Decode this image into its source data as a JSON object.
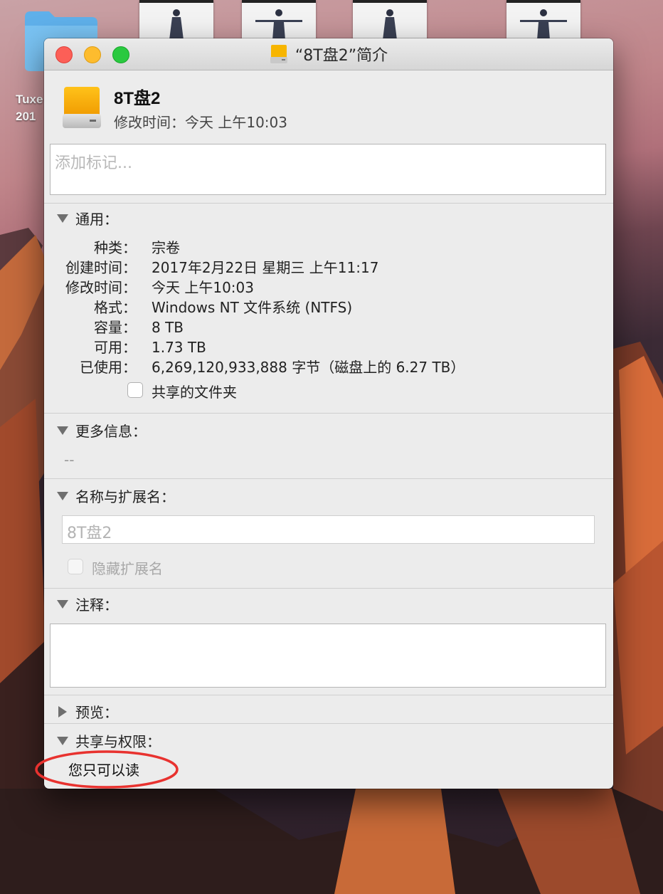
{
  "desktop": {
    "folder_label_line1": "Tuxe",
    "folder_label_line2": "201"
  },
  "window": {
    "title": "“8T盘2”简介",
    "traffic_lights": [
      "close",
      "minimize",
      "zoom"
    ]
  },
  "header": {
    "name": "8T盘2",
    "modified": "修改时间：今天 上午10:03",
    "tags_placeholder": "添加标记..."
  },
  "general": {
    "heading": "通用：",
    "rows": [
      {
        "label": "种类：",
        "value": "宗卷"
      },
      {
        "label": "创建时间：",
        "value": "2017年2月22日 星期三 上午11:17"
      },
      {
        "label": "修改时间：",
        "value": "今天 上午10:03"
      },
      {
        "label": "格式：",
        "value": "Windows NT 文件系统 (NTFS)"
      },
      {
        "label": "容量：",
        "value": "8 TB"
      },
      {
        "label": "可用：",
        "value": "1.73 TB"
      },
      {
        "label": "已使用：",
        "value": "6,269,120,933,888 字节（磁盘上的 6.27 TB）"
      }
    ],
    "shared_folder_label": "共享的文件夹",
    "shared_folder_checked": false
  },
  "more_info": {
    "heading": "更多信息：",
    "value": "--"
  },
  "name_ext": {
    "heading": "名称与扩展名：",
    "name_value": "8T盘2",
    "hide_ext_label": "隐藏扩展名",
    "hide_ext_checked": false
  },
  "comments": {
    "heading": "注释："
  },
  "preview": {
    "heading": "预览："
  },
  "sharing": {
    "heading": "共享与权限：",
    "status": "您只可以读"
  },
  "colors": {
    "annotation_circle": "#e8322f",
    "drive_icon": "#f7b500"
  }
}
